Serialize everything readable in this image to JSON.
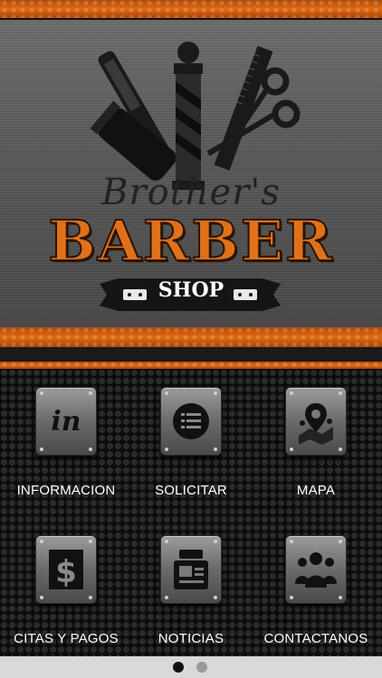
{
  "header": {
    "logo_script": "Brother's",
    "logo_main": "BARBER",
    "logo_sub": "SHOP"
  },
  "menu": [
    {
      "label": "INFORMACION",
      "icon": "info-in-icon"
    },
    {
      "label": "SOLICITAR",
      "icon": "list-icon"
    },
    {
      "label": "MAPA",
      "icon": "map-pin-icon"
    },
    {
      "label": "CITAS Y PAGOS",
      "icon": "dollar-icon"
    },
    {
      "label": "NOTICIAS",
      "icon": "news-icon"
    },
    {
      "label": "CONTACTANOS",
      "icon": "people-icon"
    }
  ],
  "pager": {
    "page_count": 2,
    "current_page": 1
  },
  "colors": {
    "accent": "#e0711a",
    "background": "#0c0c0c",
    "pager_bar": "#d9d9d9"
  }
}
